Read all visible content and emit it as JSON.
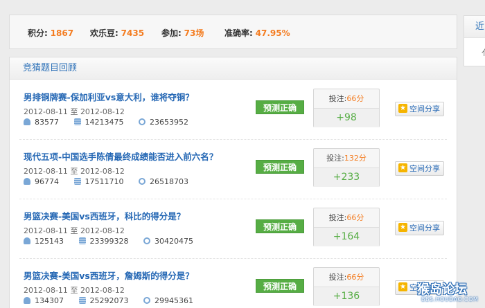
{
  "stats": {
    "points_label": "积分:",
    "points_value": "1867",
    "beans_label": "欢乐豆:",
    "beans_value": "7435",
    "joined_label": "参加:",
    "joined_value": "73场",
    "accuracy_label": "准确率:",
    "accuracy_value": "47.95%"
  },
  "main": {
    "title": "竞猜题目回顾",
    "date_sep": "至",
    "bet_label": "投注:",
    "items": [
      {
        "title": "男排铜牌赛-保加利亚vs意大利，谁将夺铜？",
        "start": "2012-08-11",
        "end": "2012-08-12",
        "m1": "83577",
        "m2": "14213475",
        "m3": "23653952",
        "result": "预测正确",
        "bet": "66分",
        "gain": "+98",
        "share": "空间分享"
      },
      {
        "title": "现代五项-中国选手陈倩最终成绩能否进入前六名？",
        "start": "2012-08-11",
        "end": "2012-08-12",
        "m1": "96774",
        "m2": "17511710",
        "m3": "26518703",
        "result": "预测正确",
        "bet": "132分",
        "gain": "+233",
        "share": "空间分享"
      },
      {
        "title": "男篮决赛-美国vs西班牙，科比的得分是？",
        "start": "2012-08-11",
        "end": "2012-08-12",
        "m1": "125143",
        "m2": "23399328",
        "m3": "30420475",
        "result": "预测正确",
        "bet": "66分",
        "gain": "+164",
        "share": "空间分享"
      },
      {
        "title": "男篮决赛-美国vs西班牙，詹姆斯的得分是？",
        "start": "2012-08-11",
        "end": "2012-08-12",
        "m1": "134307",
        "m2": "25292073",
        "m3": "29945361",
        "result": "预测正确",
        "bet": "66分",
        "gain": "+136",
        "share": "空间分享"
      }
    ]
  },
  "side": {
    "tab": "近",
    "text": "亻"
  },
  "watermark": {
    "main": "猴岛论坛",
    "sub": "BBS.HOUDAO.COM"
  },
  "colors": {
    "accent": "#2a6fb7",
    "orange": "#f47c20",
    "green": "#56ad44"
  }
}
